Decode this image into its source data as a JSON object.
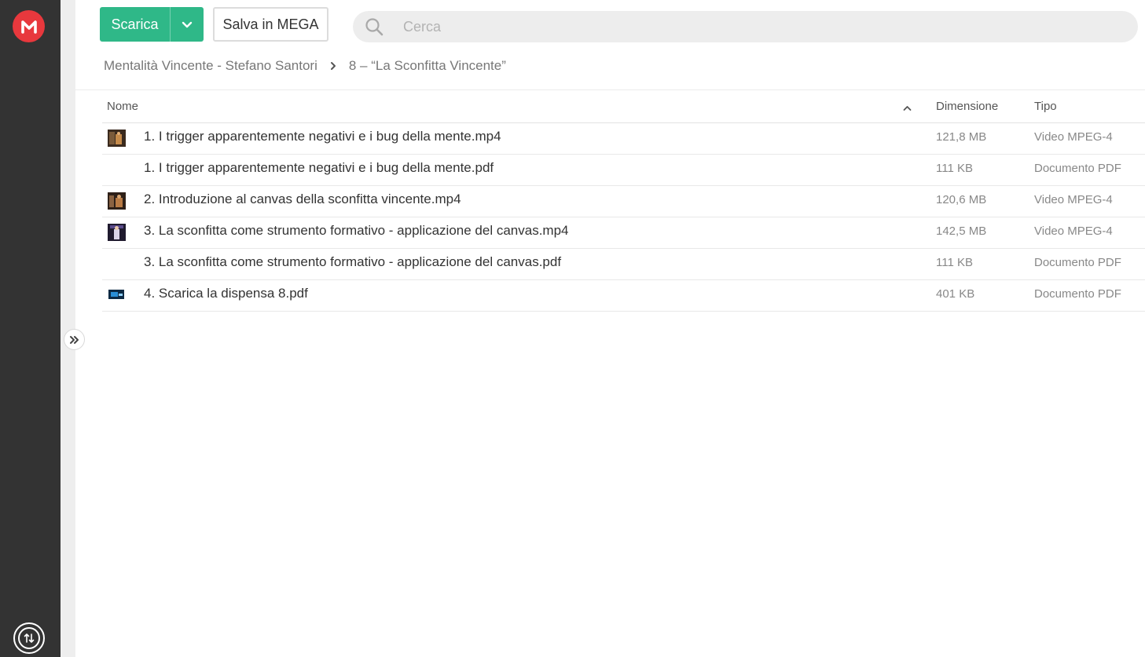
{
  "app": {
    "logo_icon": "mega-logo-icon",
    "accent_color": "#e8383d",
    "primary_color": "#2fb888",
    "transfers_icon": "transfers-icon",
    "expand_icon": "chevron-double-right-icon"
  },
  "toolbar": {
    "download_label": "Scarica",
    "save_label": "Salva in MEGA",
    "search_placeholder": "Cerca",
    "search_value": ""
  },
  "breadcrumb": {
    "items": [
      "Mentalità Vincente - Stefano Santori",
      "8 – “La Sconfitta Vincente”"
    ]
  },
  "table": {
    "headers": {
      "name": "Nome",
      "size": "Dimensione",
      "type": "Tipo"
    },
    "sort": {
      "column": "name",
      "direction": "ascending"
    },
    "rows": [
      {
        "name": "1. I trigger apparentemente negativi e i bug della mente.mp4",
        "size": "121,8 MB",
        "type": "Video MPEG-4",
        "thumb": "video-thumbnail"
      },
      {
        "name": "1. I trigger apparentemente negativi e i bug della mente.pdf",
        "size": "111 KB",
        "type": "Documento PDF",
        "thumb": ""
      },
      {
        "name": "2. Introduzione al canvas della sconfitta vincente.mp4",
        "size": "120,6 MB",
        "type": "Video MPEG-4",
        "thumb": "video-thumbnail"
      },
      {
        "name": "3. La sconfitta come strumento formativo - applicazione del canvas.mp4",
        "size": "142,5 MB",
        "type": "Video MPEG-4",
        "thumb": "video-thumbnail"
      },
      {
        "name": "3. La sconfitta come strumento formativo - applicazione del canvas.pdf",
        "size": "111 KB",
        "type": "Documento PDF",
        "thumb": ""
      },
      {
        "name": "4. Scarica la dispensa 8.pdf",
        "size": "401 KB",
        "type": "Documento PDF",
        "thumb": "pdf-thumbnail"
      }
    ]
  }
}
